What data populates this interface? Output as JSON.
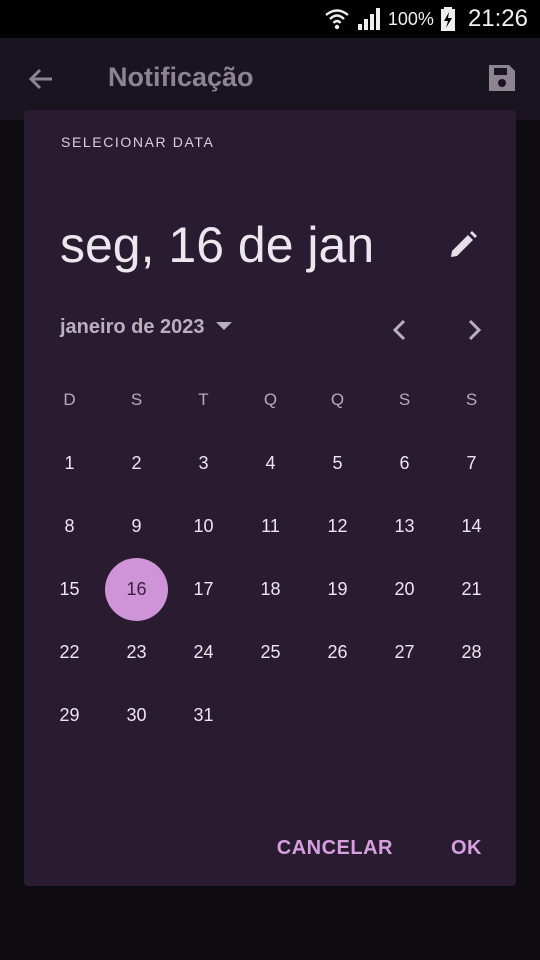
{
  "statusbar": {
    "battery": "100%",
    "time": "21:26"
  },
  "appbar": {
    "title": "Notificação"
  },
  "dialog": {
    "label": "SELECIONAR DATA",
    "headline": "seg, 16 de jan",
    "month": "janeiro de 2023",
    "weekdays": [
      "D",
      "S",
      "T",
      "Q",
      "Q",
      "S",
      "S"
    ],
    "days": [
      "1",
      "2",
      "3",
      "4",
      "5",
      "6",
      "7",
      "8",
      "9",
      "10",
      "11",
      "12",
      "13",
      "14",
      "15",
      "16",
      "17",
      "18",
      "19",
      "20",
      "21",
      "22",
      "23",
      "24",
      "25",
      "26",
      "27",
      "28",
      "29",
      "30",
      "31"
    ],
    "selected_day": "16",
    "cancel_label": "CANCELAR",
    "ok_label": "OK"
  },
  "colors": {
    "dialog_bg": "#2a1c30",
    "accent": "#d79fe0",
    "selected_bg": "#cf93d8"
  }
}
